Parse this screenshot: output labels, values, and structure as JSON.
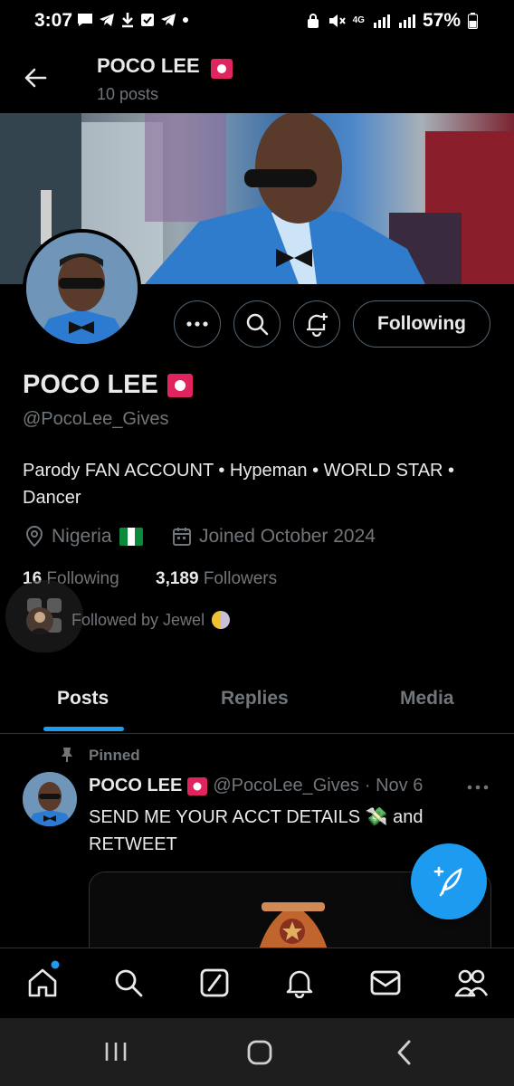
{
  "status_bar": {
    "time": "3:07",
    "battery": "57%",
    "network": "4G"
  },
  "header": {
    "name": "POCO LEE",
    "posts_count": "10 posts"
  },
  "profile": {
    "name": "POCO LEE",
    "handle": "@PocoLee_Gives",
    "bio": "Parody FAN ACCOUNT • Hypeman • WORLD STAR • Dancer",
    "location": "Nigeria",
    "joined": "Joined October 2024",
    "following_count": "16",
    "following_label": "Following",
    "followers_count": "3,189",
    "followers_label": "Followers",
    "followed_by": "Followed by Jewel"
  },
  "actions": {
    "following_button": "Following"
  },
  "tabs": [
    {
      "label": "Posts"
    },
    {
      "label": "Replies"
    },
    {
      "label": "Media"
    }
  ],
  "post": {
    "pinned_label": "Pinned",
    "author_name": "POCO LEE",
    "author_handle": "@PocoLee_Gives",
    "date": "· Nov 6",
    "text": "SEND ME YOUR ACCT DETAILS 💸 and RETWEET"
  },
  "colors": {
    "accent": "#1d9bf0",
    "badge": "#e0245e",
    "background": "#000000",
    "muted": "#71767b"
  }
}
